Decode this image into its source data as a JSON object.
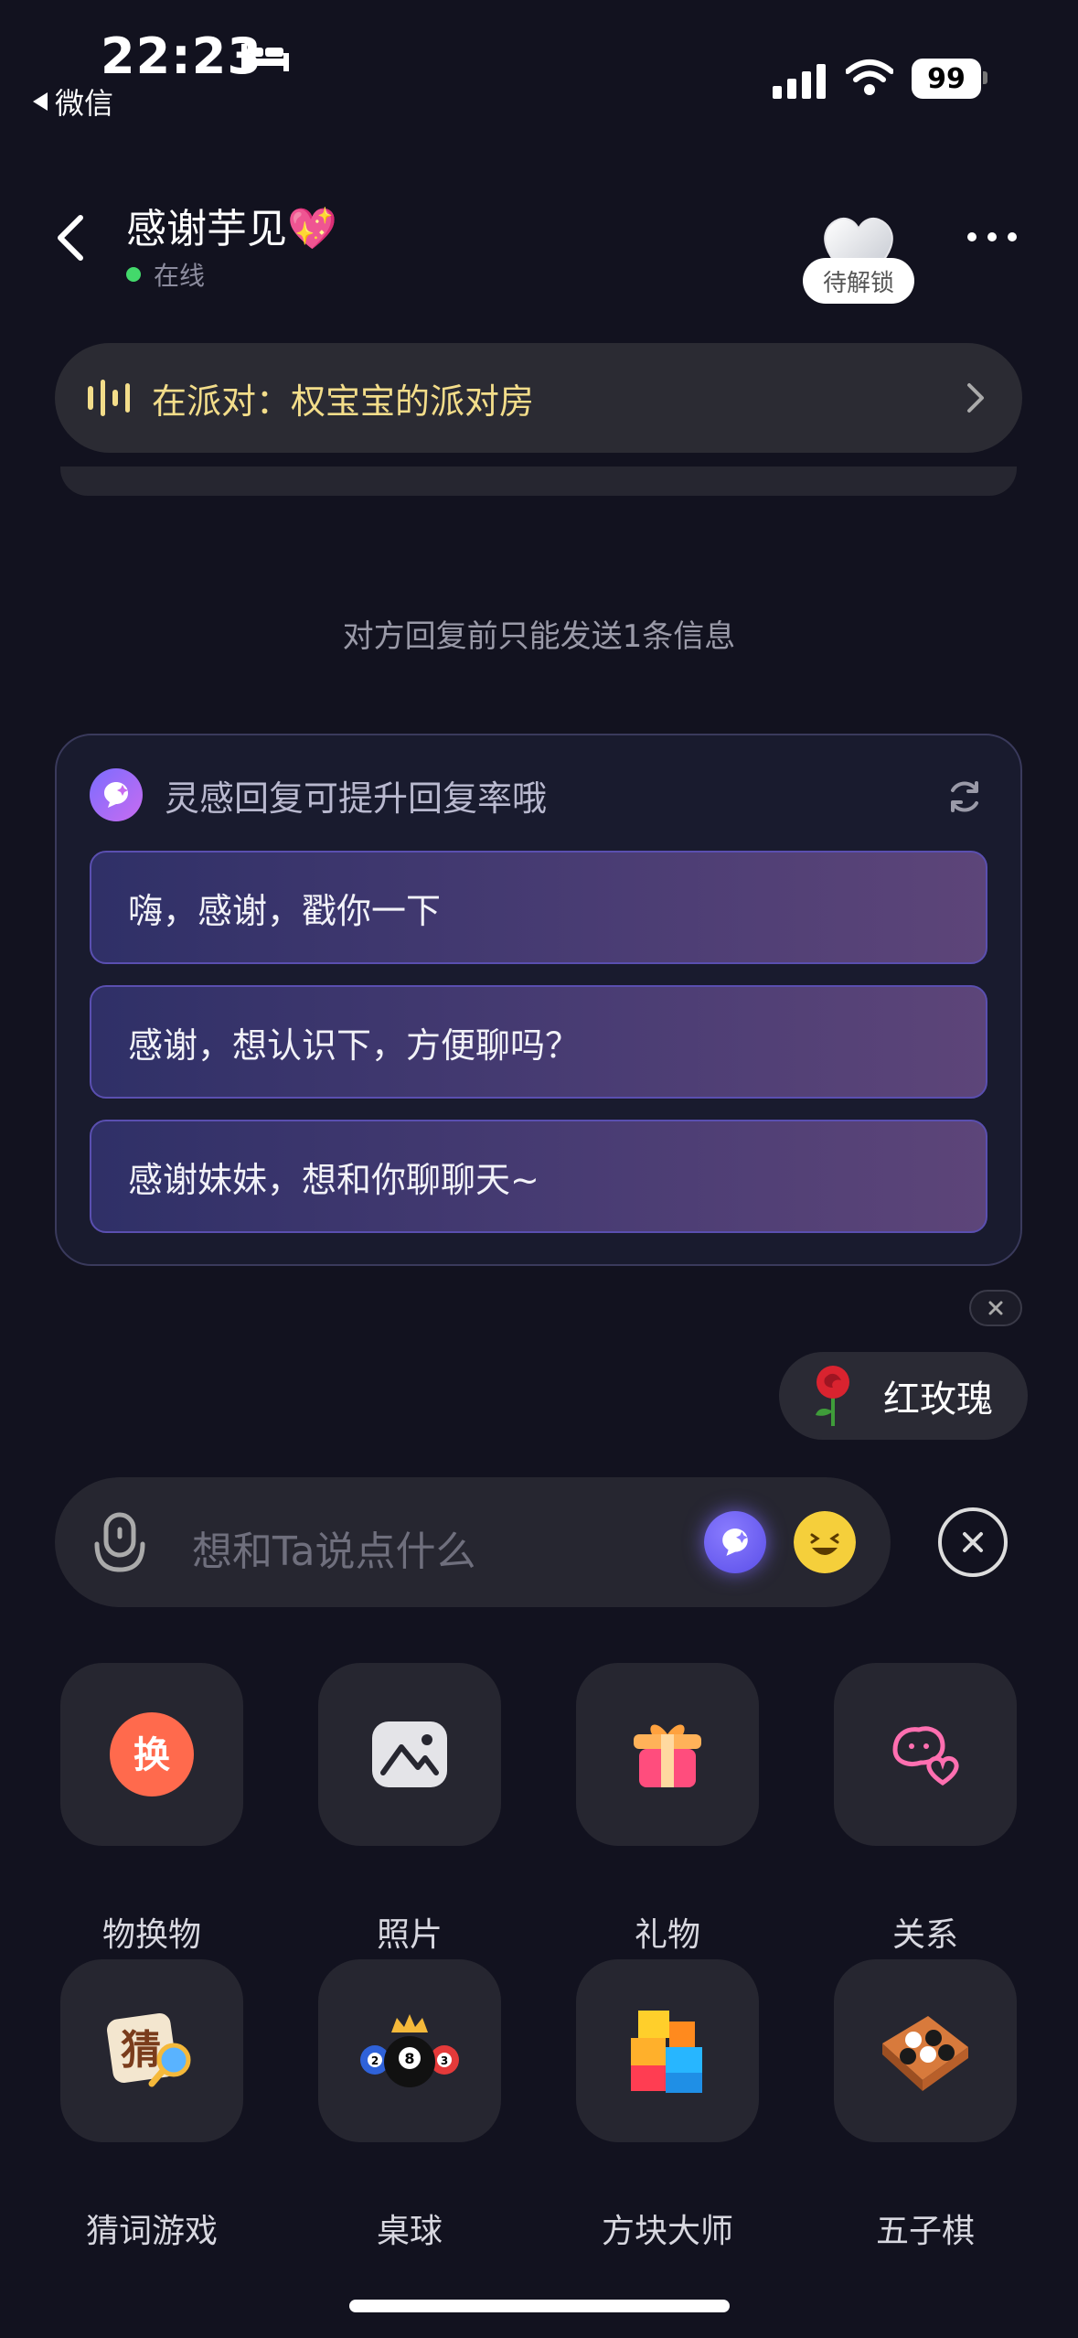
{
  "status_bar": {
    "time": "22:23",
    "back_app": "微信",
    "battery": "99"
  },
  "header": {
    "title": "感谢芋见💖",
    "online_status": "在线",
    "unlock_badge": "待解锁"
  },
  "party_banner": {
    "text": "在派对：权宝宝的派对房"
  },
  "notice": "对方回复前只能发送1条信息",
  "inspiration": {
    "title": "灵感回复可提升回复率哦",
    "options": [
      "嗨，感谢，戳你一下",
      "感谢，想认识下，方便聊吗？",
      "感谢妹妹，想和你聊聊天~"
    ]
  },
  "gift_suggestion": {
    "label": "红玫瑰"
  },
  "input": {
    "placeholder": "想和Ta说点什么"
  },
  "features": [
    {
      "label": "物换物",
      "icon": "swap-icon"
    },
    {
      "label": "照片",
      "icon": "photo-icon"
    },
    {
      "label": "礼物",
      "icon": "gift-icon"
    },
    {
      "label": "关系",
      "icon": "relationship-icon"
    },
    {
      "label": "猜词游戏",
      "icon": "word-guess-icon"
    },
    {
      "label": "桌球",
      "icon": "billiards-icon"
    },
    {
      "label": "方块大师",
      "icon": "blocks-icon"
    },
    {
      "label": "五子棋",
      "icon": "gomoku-icon"
    }
  ],
  "colors": {
    "background": "#12121f",
    "party_text": "#f3dd8a",
    "online_dot": "#43d96b",
    "accent_purple": "#5a4ee8"
  }
}
